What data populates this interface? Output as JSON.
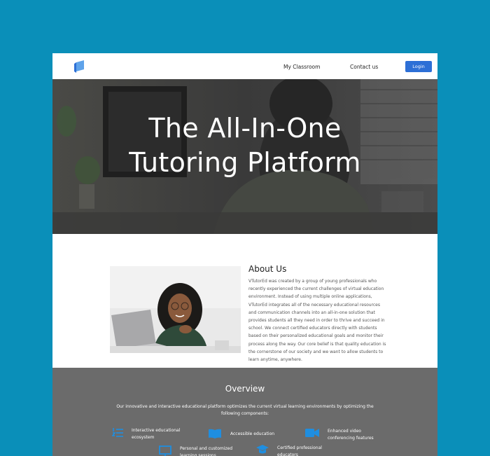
{
  "header": {
    "nav": [
      "My Classroom",
      "Contact us"
    ],
    "login_label": "Login"
  },
  "hero": {
    "title_line1": "The All-In-One",
    "title_line2": "Tutoring Platform"
  },
  "about": {
    "title": "About Us",
    "text": "VTutorEd was created by a group of young professionals who recently experienced the current challenges of virtual education environment. Instead of using multiple online applications, VTutorEd integrates all of the necessary educational resources and communication channels into an all-in-one solution that provides students all they need in order to thrive and succeed in school. We connect certified educators directly with students based on their personalized educational goals and monitor their process along the way. Our core belief is that quality education is the cornerstone of our society and we want to allow students to learn anytime, anywhere."
  },
  "overview": {
    "title": "Overview",
    "text": "Our innovative and interactive educational platform optimizes the current virtual learning environments by optimizing the following components:",
    "features": [
      {
        "icon": "ordered-list-icon",
        "label": "Interactive educational ecosystem"
      },
      {
        "icon": "book-icon",
        "label": "Accessible education"
      },
      {
        "icon": "video-camera-icon",
        "label": "Enhanced video conferencing features"
      },
      {
        "icon": "monitor-icon",
        "label": "Personal and customized learning sessions"
      },
      {
        "icon": "graduation-cap-icon",
        "label": "Certified professional educators"
      }
    ]
  },
  "colors": {
    "background": "#0a8fb9",
    "accent": "#2d6fd6",
    "overview_bg": "#6b6b6b",
    "icon_blue": "#1f8ee0"
  }
}
